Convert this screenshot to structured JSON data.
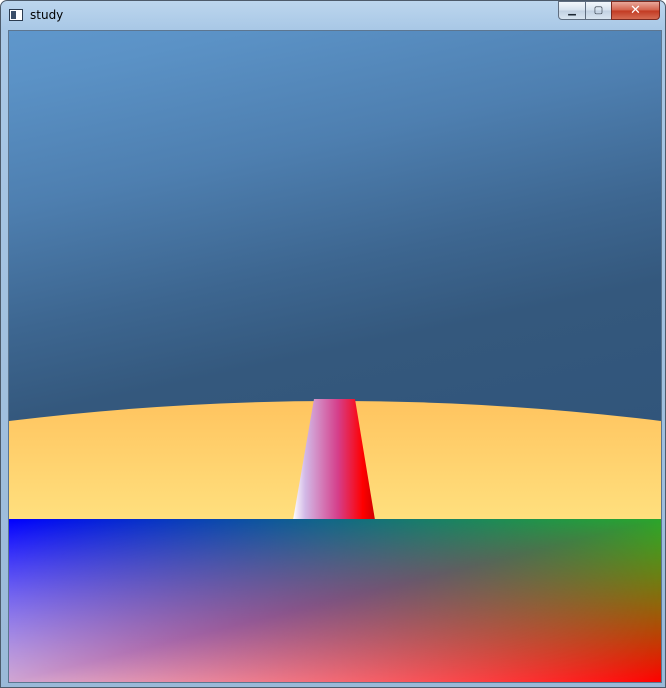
{
  "window": {
    "title": "study",
    "controls": {
      "minimize_icon": "minimize-icon",
      "maximize_icon": "maximize-icon",
      "close_icon": "close-icon"
    }
  },
  "scene": {
    "sky_colors": [
      "#5f97cc",
      "#34587d"
    ],
    "ground_colors": [
      "#ffc45f",
      "#ffe07e"
    ],
    "pillar_colors": [
      "#ffffff",
      "#d870c0",
      "#ff0000"
    ],
    "quad_corner_colors": {
      "top_left": "#0000ff",
      "top_right": "#00ff00",
      "bottom_left": "#ffffff",
      "bottom_right": "#ff0000"
    }
  }
}
